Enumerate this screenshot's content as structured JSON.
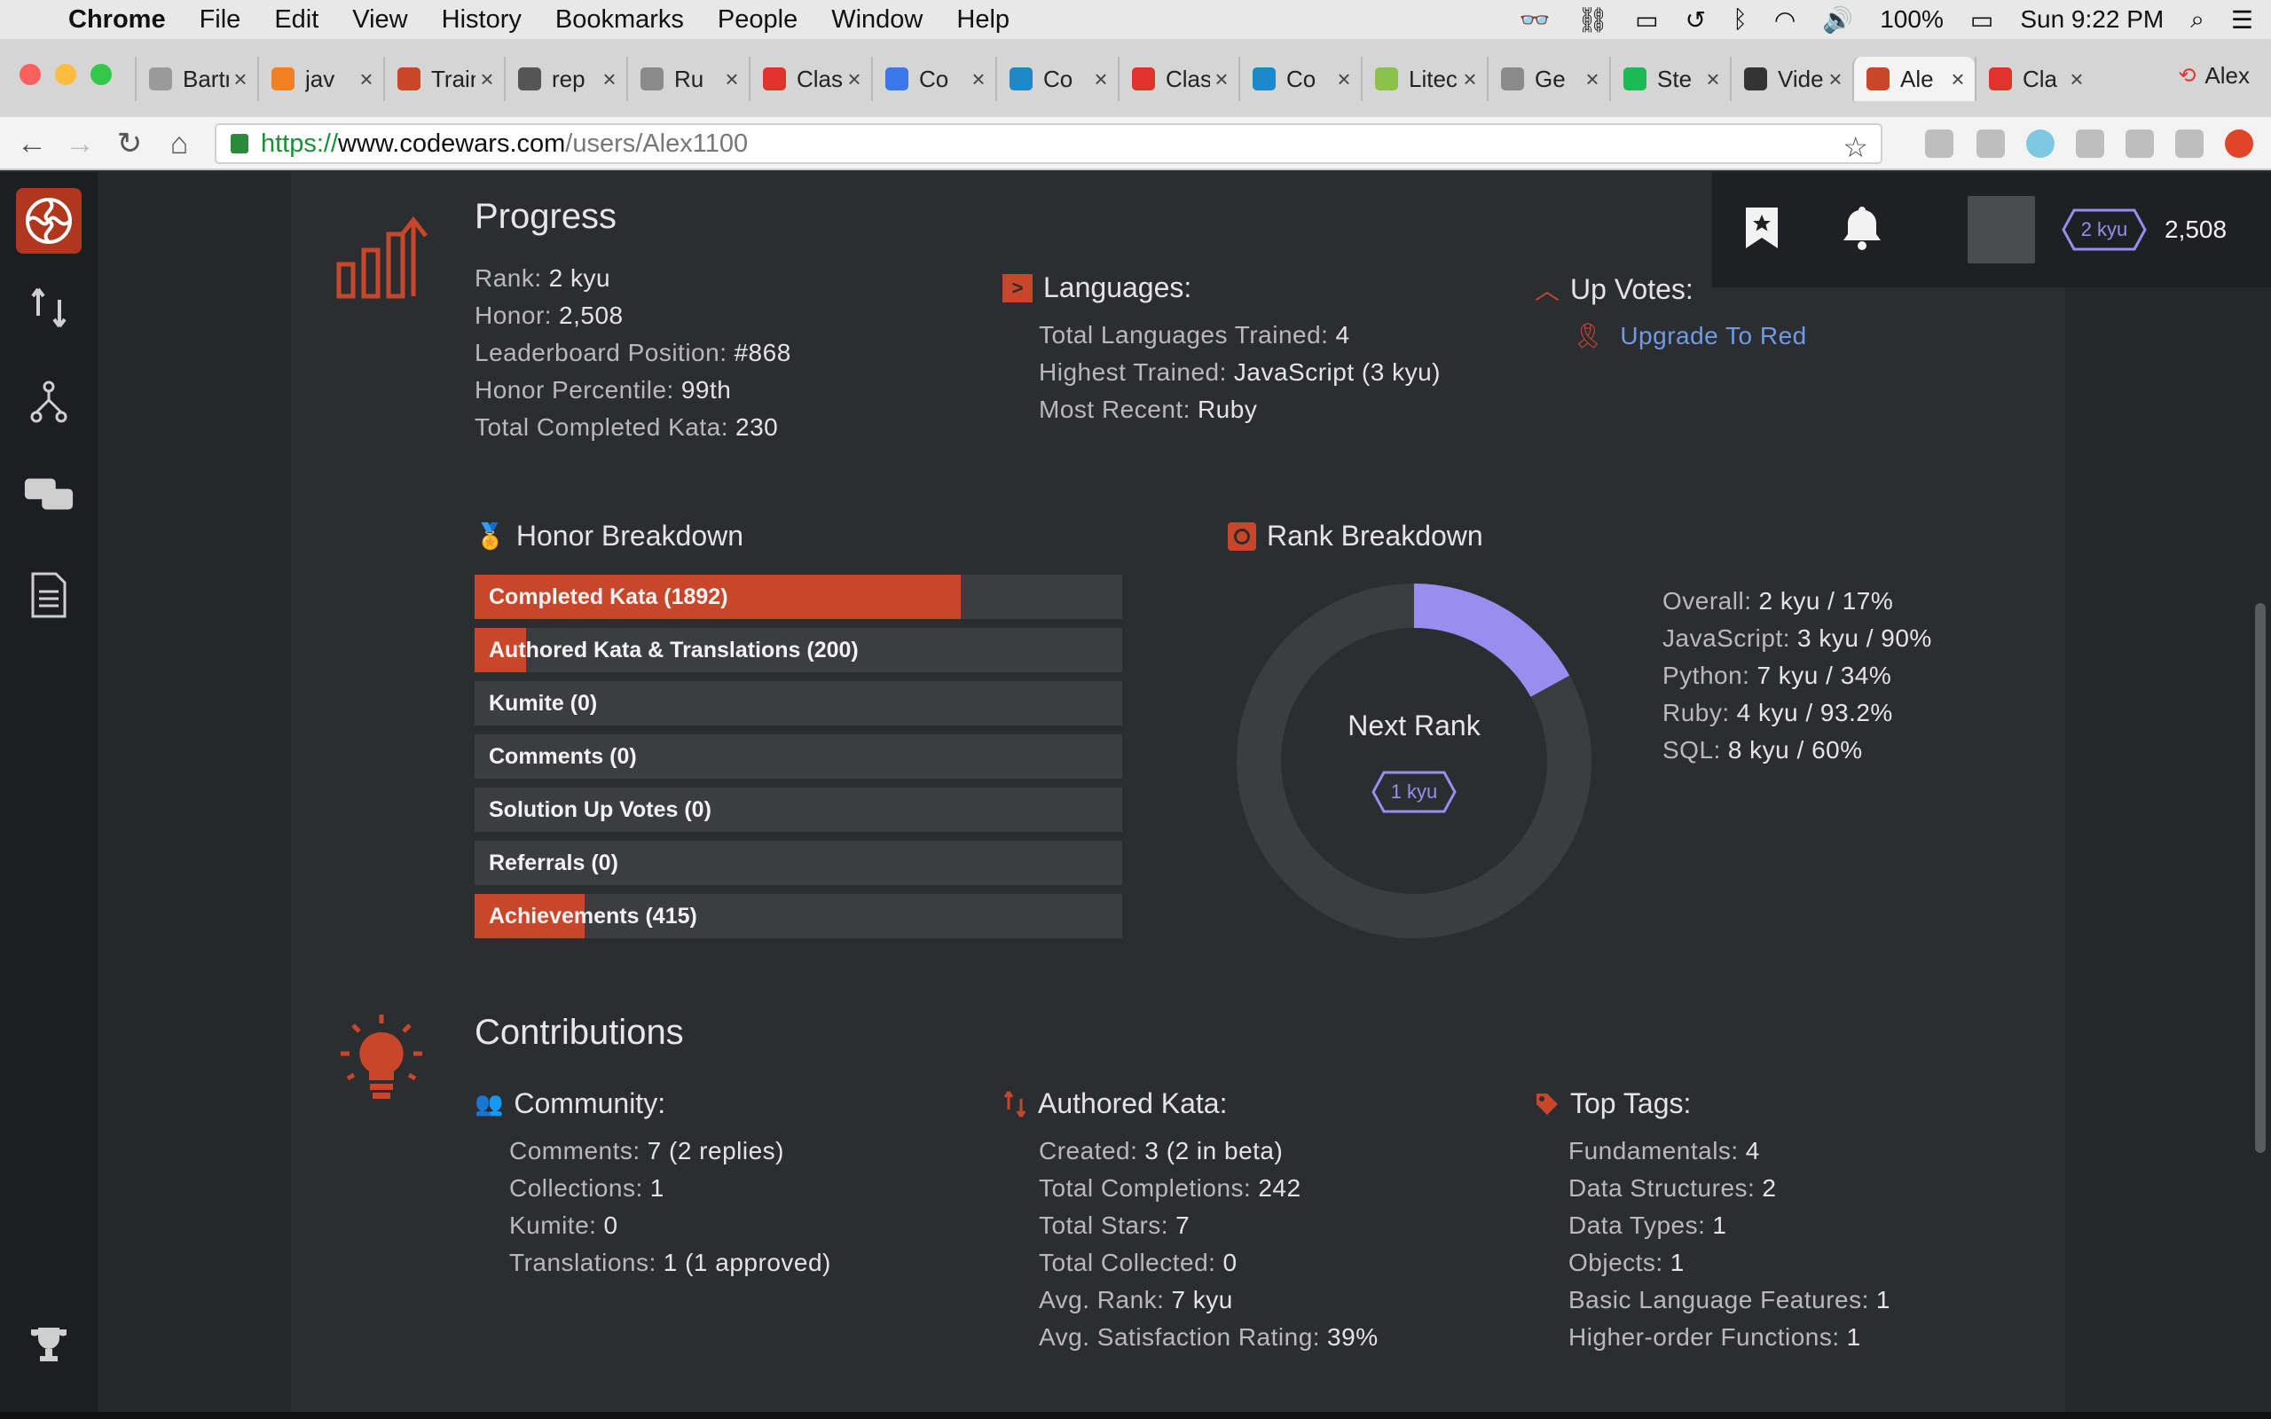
{
  "menubar": {
    "app": "Chrome",
    "items": [
      "File",
      "Edit",
      "View",
      "History",
      "Bookmarks",
      "People",
      "Window",
      "Help"
    ],
    "battery": "100%",
    "clock": "Sun 9:22 PM"
  },
  "tabs": [
    {
      "label": "Bartr",
      "color": "#9a9a9a"
    },
    {
      "label": "jav",
      "color": "#f48024"
    },
    {
      "label": "Train",
      "color": "#c8462a"
    },
    {
      "label": "rep",
      "color": "#555555"
    },
    {
      "label": "Ru",
      "color": "#8a8a8a"
    },
    {
      "label": "Class",
      "color": "#e0332b"
    },
    {
      "label": "Co",
      "color": "#3b78e7"
    },
    {
      "label": "Co",
      "color": "#1e88c8"
    },
    {
      "label": "Class",
      "color": "#e0332b"
    },
    {
      "label": "Co",
      "color": "#1e88c8"
    },
    {
      "label": "Litec",
      "color": "#8bc34a"
    },
    {
      "label": "Ge",
      "color": "#8a8a8a"
    },
    {
      "label": "Ste",
      "color": "#1db954"
    },
    {
      "label": "Video",
      "color": "#333333"
    },
    {
      "label": "Ale",
      "color": "#c8462a"
    },
    {
      "label": "Cla",
      "color": "#e0332b"
    }
  ],
  "profile_name": "Alex",
  "url": {
    "protocol": "https://",
    "host": "www.codewars.com",
    "path": "/users/Alex1100"
  },
  "user_header": {
    "rank": "2 kyu",
    "honor": "2,508"
  },
  "progress": {
    "title": "Progress",
    "stats": [
      {
        "k": "Rank:",
        "v": "2 kyu"
      },
      {
        "k": "Honor:",
        "v": "2,508"
      },
      {
        "k": "Leaderboard Position:",
        "v": "#868"
      },
      {
        "k": "Honor Percentile:",
        "v": "99th"
      },
      {
        "k": "Total Completed Kata:",
        "v": "230"
      }
    ]
  },
  "languages": {
    "title": "Languages:",
    "stats": [
      {
        "k": "Total Languages Trained:",
        "v": "4"
      },
      {
        "k": "Highest Trained:",
        "v": "JavaScript (3 kyu)"
      },
      {
        "k": "Most Recent:",
        "v": "Ruby"
      }
    ]
  },
  "upvotes": {
    "title": "Up Votes:",
    "link": "Upgrade To Red"
  },
  "honor_breakdown": {
    "title": "Honor Breakdown",
    "bars": [
      {
        "label": "Completed Kata (1892)",
        "fill": 0.75
      },
      {
        "label": "Authored Kata & Translations (200)",
        "fill": 0.08
      },
      {
        "label": "Kumite (0)",
        "fill": 0
      },
      {
        "label": "Comments (0)",
        "fill": 0
      },
      {
        "label": "Solution Up Votes (0)",
        "fill": 0
      },
      {
        "label": "Referrals (0)",
        "fill": 0
      },
      {
        "label": "Achievements (415)",
        "fill": 0.17
      }
    ]
  },
  "rank_breakdown": {
    "title": "Rank Breakdown",
    "center_label": "Next Rank",
    "next_rank": "1 kyu",
    "progress": 0.17,
    "stats": [
      {
        "k": "Overall:",
        "v": "2 kyu / 17%"
      },
      {
        "k": "JavaScript:",
        "v": "3 kyu / 90%"
      },
      {
        "k": "Python:",
        "v": "7 kyu / 34%"
      },
      {
        "k": "Ruby:",
        "v": "4 kyu / 93.2%"
      },
      {
        "k": "SQL:",
        "v": "8 kyu / 60%"
      }
    ]
  },
  "contributions": {
    "title": "Contributions",
    "community": {
      "title": "Community:",
      "stats": [
        {
          "k": "Comments:",
          "v": "7 (2 replies)"
        },
        {
          "k": "Collections:",
          "v": "1"
        },
        {
          "k": "Kumite:",
          "v": "0"
        },
        {
          "k": "Translations:",
          "v": "1 (1 approved)"
        }
      ]
    },
    "authored": {
      "title": "Authored Kata:",
      "stats": [
        {
          "k": "Created:",
          "v": "3 (2 in beta)"
        },
        {
          "k": "Total Completions:",
          "v": "242"
        },
        {
          "k": "Total Stars:",
          "v": "7"
        },
        {
          "k": "Total Collected:",
          "v": "0"
        },
        {
          "k": "Avg. Rank:",
          "v": "7 kyu"
        },
        {
          "k": "Avg. Satisfaction Rating:",
          "v": "39%"
        }
      ]
    },
    "tags": {
      "title": "Top Tags:",
      "stats": [
        {
          "k": "Fundamentals:",
          "v": "4"
        },
        {
          "k": "Data Structures:",
          "v": "2"
        },
        {
          "k": "Data Types:",
          "v": "1"
        },
        {
          "k": "Objects:",
          "v": "1"
        },
        {
          "k": "Basic Language Features:",
          "v": "1"
        },
        {
          "k": "Higher-order Functions:",
          "v": "1"
        }
      ]
    }
  },
  "colors": {
    "accent": "#c8462a",
    "rank_purple": "#9b8df0",
    "link": "#6f9be3"
  }
}
